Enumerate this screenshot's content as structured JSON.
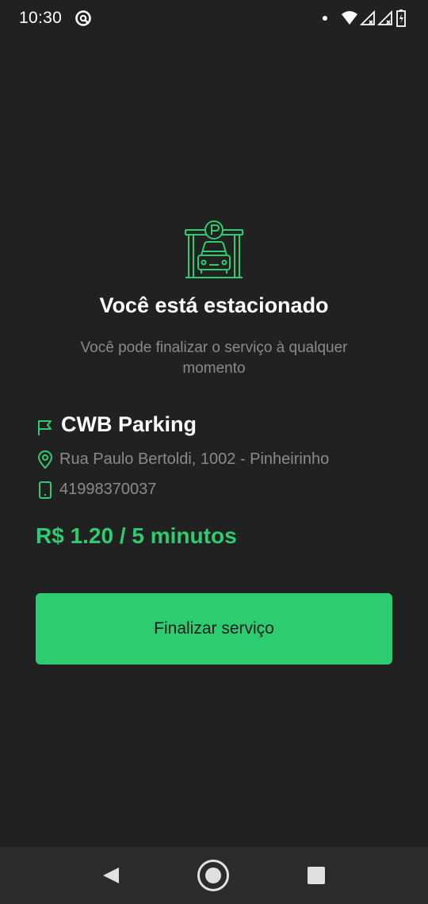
{
  "status_bar": {
    "time": "10:30",
    "icons": [
      "app-notification-icon",
      "dot-icon",
      "wifi-icon",
      "signal-icon",
      "signal-icon",
      "battery-icon"
    ]
  },
  "main": {
    "hero_icon": "parking-garage-icon",
    "title": "Você está estacionado",
    "subtitle": "Você pode finalizar o serviço à qualquer momento",
    "parking": {
      "name": "CWB Parking",
      "address": "Rua Paulo Bertoldi, 1002 - Pinheirinho",
      "phone": "41998370037",
      "price": "R$ 1.20 / 5 minutos"
    },
    "finish_button_label": "Finalizar serviço"
  },
  "colors": {
    "background": "#212121",
    "accent": "#2ecc71",
    "muted_text": "#8a8a8a",
    "nav_bar": "#2b2b2b"
  },
  "nav_bar": {
    "icons": [
      "back-icon",
      "home-icon",
      "recents-icon"
    ]
  }
}
